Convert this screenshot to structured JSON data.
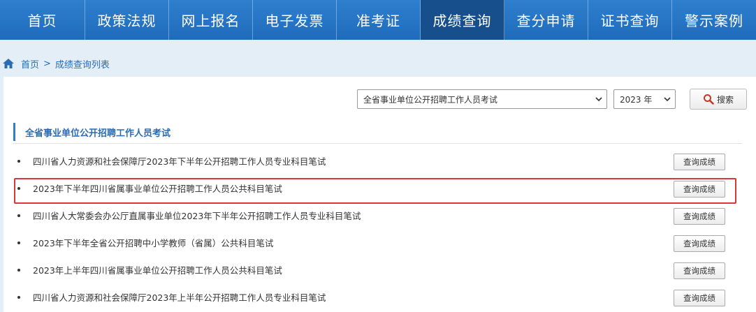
{
  "nav": {
    "items": [
      {
        "label": "首页"
      },
      {
        "label": "政策法规"
      },
      {
        "label": "网上报名"
      },
      {
        "label": "电子发票"
      },
      {
        "label": "准考证"
      },
      {
        "label": "成绩查询"
      },
      {
        "label": "查分申请"
      },
      {
        "label": "证书查询"
      },
      {
        "label": "警示案例"
      }
    ],
    "active_index": 5
  },
  "breadcrumb": {
    "home": "首页",
    "separator": ">",
    "current": "成绩查询列表"
  },
  "filters": {
    "exam_select_value": "全省事业单位公开招聘工作人员考试",
    "year_select_value": "2023 年",
    "search_label": "搜索"
  },
  "section": {
    "title": "全省事业单位公开招聘工作人员考试"
  },
  "list": {
    "button_label": "查询成绩",
    "items": [
      {
        "text": "四川省人力资源和社会保障厅2023年下半年公开招聘工作人员专业科目笔试"
      },
      {
        "text": "2023年下半年四川省属事业单位公开招聘工作人员公共科目笔试"
      },
      {
        "text": "四川省人大常委会办公厅直属事业单位2023年下半年公开招聘工作人员专业科目笔试"
      },
      {
        "text": "2023年下半年全省公开招聘中小学教师（省属）公共科目笔试"
      },
      {
        "text": "2023年上半年四川省属事业单位公开招聘工作人员公共科目笔试"
      },
      {
        "text": "四川省人力资源和社会保障厅2023年上半年公开招聘工作人员专业科目笔试"
      }
    ],
    "highlighted_index": 1
  },
  "colors": {
    "nav_bg": "#1f6bbb",
    "nav_active": "#174f8c",
    "highlight": "#d9383a",
    "accent": "#2a6cb3"
  },
  "icons": {
    "home": "home-icon",
    "search": "search-icon",
    "dropdown": "chevron-down-icon"
  }
}
